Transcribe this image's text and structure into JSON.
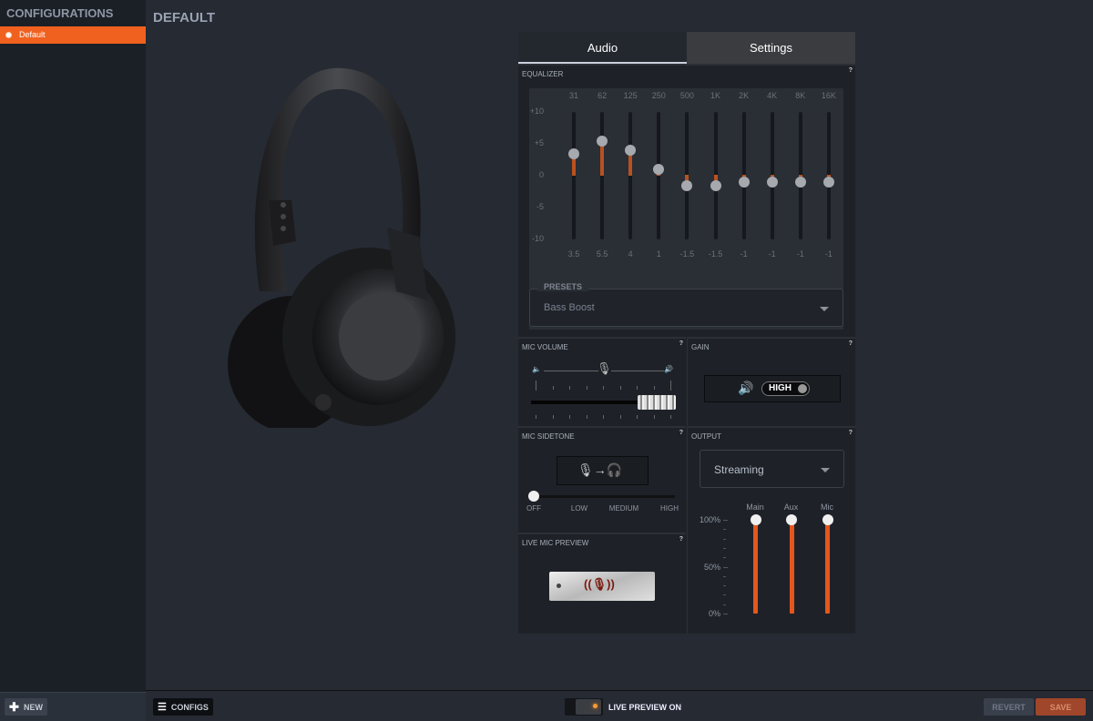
{
  "sidebar": {
    "title": "CONFIGURATIONS",
    "items": [
      {
        "label": "Default",
        "active": true
      }
    ],
    "new_label": "NEW"
  },
  "page": {
    "title": "DEFAULT"
  },
  "tabs": [
    {
      "label": "Audio",
      "active": true
    },
    {
      "label": "Settings",
      "active": false
    }
  ],
  "equalizer": {
    "label": "EQUALIZER",
    "help": "?",
    "y_labels": [
      "+10",
      "+5",
      "0",
      "-5",
      "-10"
    ],
    "bands": [
      {
        "freq": "31",
        "value": 3.5,
        "text": "3.5"
      },
      {
        "freq": "62",
        "value": 5.5,
        "text": "5.5"
      },
      {
        "freq": "125",
        "value": 4,
        "text": "4"
      },
      {
        "freq": "250",
        "value": 1,
        "text": "1"
      },
      {
        "freq": "500",
        "value": -1.5,
        "text": "-1.5"
      },
      {
        "freq": "1K",
        "value": -1.5,
        "text": "-1.5"
      },
      {
        "freq": "2K",
        "value": -1,
        "text": "-1"
      },
      {
        "freq": "4K",
        "value": -1,
        "text": "-1"
      },
      {
        "freq": "8K",
        "value": -1,
        "text": "-1"
      },
      {
        "freq": "16K",
        "value": -1,
        "text": "-1"
      }
    ],
    "range": [
      -10,
      10
    ],
    "presets_label": "PRESETS",
    "preset_value": "Bass Boost"
  },
  "mic_volume": {
    "label": "MIC VOLUME",
    "help": "?",
    "level_percent": 100
  },
  "gain": {
    "label": "GAIN",
    "help": "?",
    "value": "HIGH"
  },
  "mic_sidetone": {
    "label": "MIC SIDETONE",
    "help": "?",
    "levels": [
      "OFF",
      "LOW",
      "MEDIUM",
      "HIGH"
    ],
    "selected": "OFF"
  },
  "live_mic_preview": {
    "label": "LIVE MIC PREVIEW",
    "help": "?"
  },
  "output": {
    "label": "OUTPUT",
    "help": "?",
    "selected": "Streaming",
    "scale": [
      "100%",
      "50%",
      "0%"
    ],
    "channels": [
      {
        "name": "Main",
        "percent": 100
      },
      {
        "name": "Aux",
        "percent": 100
      },
      {
        "name": "Mic",
        "percent": 100
      }
    ]
  },
  "footer": {
    "configs_label": "CONFIGS",
    "live_preview_label": "LIVE PREVIEW ON",
    "revert_label": "REVERT",
    "save_label": "SAVE"
  },
  "colors": {
    "accent": "#f0611f",
    "eq_fill": "#b9521f",
    "save": "#a0462a"
  }
}
